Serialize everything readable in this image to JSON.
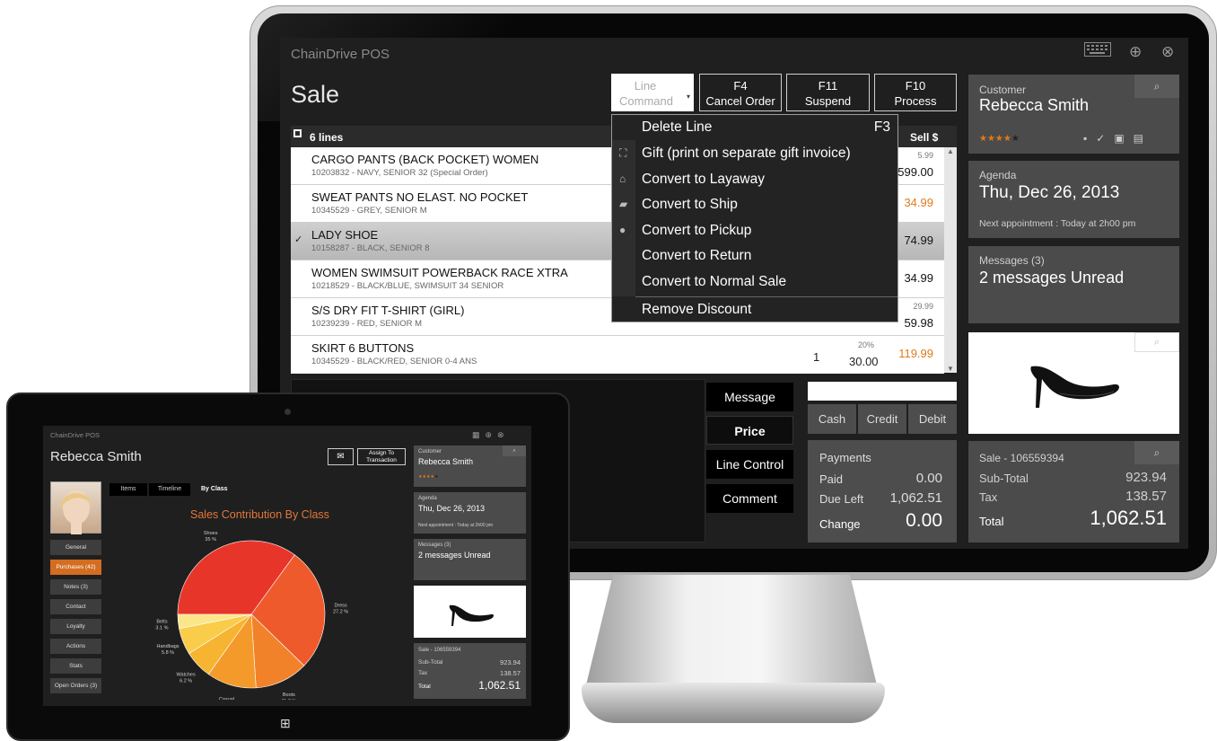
{
  "app": {
    "title": "ChainDrive POS",
    "page_title": "Sale"
  },
  "toolbar": {
    "line_command": "Line Command",
    "cancel_key": "F4",
    "cancel_label": "Cancel Order",
    "suspend_key": "F11",
    "suspend_label": "Suspend",
    "process_key": "F10",
    "process_label": "Process"
  },
  "grid": {
    "header_count": "6 lines",
    "header_sell": "Sell $",
    "rows": [
      {
        "name": "CARGO PANTS (BACK POCKET) WOMEN",
        "sub": "10203832 - NAVY, SENIOR 32 (Special Order)",
        "orig": "5.99",
        "price": "599.00"
      },
      {
        "name": "SWEAT PANTS NO ELAST. NO POCKET",
        "sub": "10345529 - GREY, SENIOR  M",
        "price": "34.99"
      },
      {
        "name": "LADY SHOE",
        "sub": "10158287 - BLACK, SENIOR 8",
        "price": "74.99"
      },
      {
        "name": "WOMEN SWIMSUIT POWERBACK RACE XTRA",
        "sub": "10218529 - BLACK/BLUE, SWIMSUIT 34 SENIOR",
        "price": "34.99"
      },
      {
        "name": "S/S DRY FIT T-SHIRT (GIRL)",
        "sub": "10239239 - RED, SENIOR  M",
        "orig": "29.99",
        "price": "59.98"
      },
      {
        "name": "SKIRT 6 BUTTONS",
        "sub": "10345529 - BLACK/RED, SENIOR 0-4 ANS",
        "qty": "1",
        "discount": "20%",
        "net": "30.00",
        "price": "119.99"
      }
    ]
  },
  "menu": {
    "items": [
      {
        "label": "Delete Line",
        "key": "F3"
      },
      {
        "label": "Gift (print on separate gift invoice)"
      },
      {
        "label": "Convert to Layaway"
      },
      {
        "label": "Convert to Ship"
      },
      {
        "label": "Convert to Pickup"
      },
      {
        "label": "Convert to Return"
      },
      {
        "label": "Convert to Normal Sale"
      },
      {
        "label": "Remove Discount"
      }
    ]
  },
  "actions": {
    "message": "Message",
    "price": "Price",
    "line_control": "Line Control",
    "comment": "Comment"
  },
  "tender": {
    "cash": "Cash",
    "credit": "Credit",
    "debit": "Debit"
  },
  "payments": {
    "title": "Payments",
    "paid_label": "Paid",
    "paid": "0.00",
    "due_label": "Due Left",
    "due": "1,062.51",
    "change_label": "Change",
    "change": "0.00"
  },
  "customer": {
    "label": "Customer",
    "name": "Rebecca Smith",
    "rating": 4
  },
  "agenda": {
    "label": "Agenda",
    "date": "Thu, Dec 26, 2013",
    "next": "Next appointment : Today at 2h00 pm"
  },
  "messages": {
    "label": "Messages (3)",
    "text": "2 messages Unread"
  },
  "sale": {
    "label": "Sale - 106559394",
    "subtotal_label": "Sub-Total",
    "subtotal": "923.94",
    "tax_label": "Tax",
    "tax": "138.57",
    "total_label": "Total",
    "total": "1,062.51"
  },
  "tablet": {
    "app_title": "ChainDrive POS",
    "customer_name": "Rebecca Smith",
    "assign": "Assign To Transaction",
    "tabs": [
      "Items",
      "Timeline",
      "By Class"
    ],
    "nav": [
      "General",
      "Purchases (42)",
      "Notes (3)",
      "Contact",
      "Loyalty",
      "Actions",
      "Stats",
      "Open Orders (3)"
    ],
    "next_short": "Next appointment : Today at 2h00 pm"
  },
  "chart_data": {
    "type": "pie",
    "title": "Sales Contribution By Class",
    "slices": [
      {
        "label": "Shoes",
        "value": 35,
        "color": "#e8352a"
      },
      {
        "label": "Dress",
        "value": 27.2,
        "color": "#ef5a2c"
      },
      {
        "label": "Boots",
        "value": 11.7,
        "color": "#f1822a"
      },
      {
        "label": "Casual",
        "value": 10.9,
        "color": "#f49a2b"
      },
      {
        "label": "Watches",
        "value": 6.2,
        "color": "#f7b431"
      },
      {
        "label": "Handbags",
        "value": 5.8,
        "color": "#f9cd4a"
      },
      {
        "label": "Belts",
        "value": 3.1,
        "color": "#fbe68a"
      }
    ],
    "slice_labels": [
      "Shoes\n35 %",
      "Dress\n27.2 %",
      "Boots\n11.7 %",
      "Casual\n10.9 %",
      "Watches\n6.2 %",
      "Handbags\n5.8 %",
      "Belts\n3.1 %"
    ]
  },
  "colors": {
    "accent": "#e07a1a",
    "panel": "#4b4b4b",
    "screen": "#1f1f1f"
  }
}
